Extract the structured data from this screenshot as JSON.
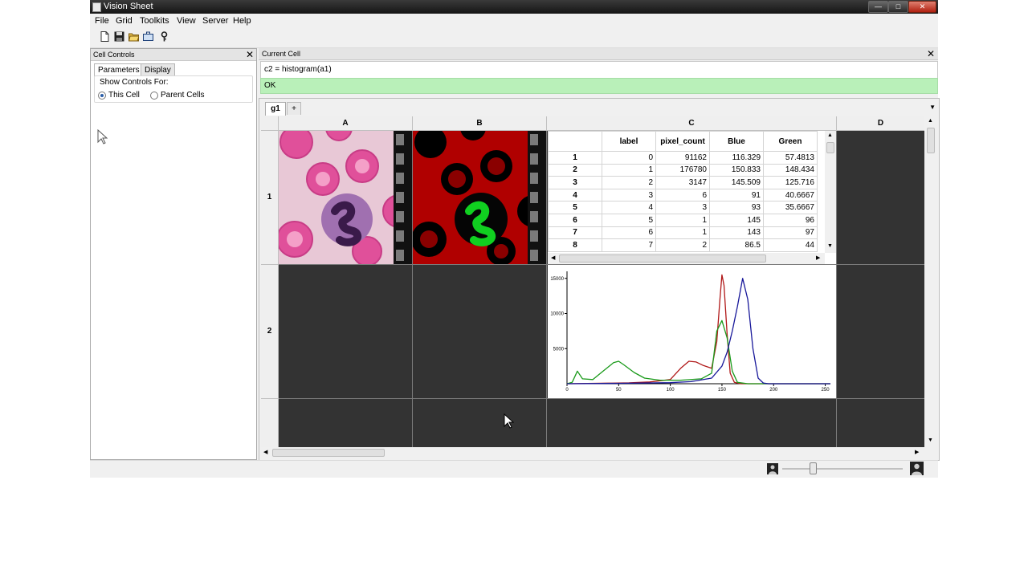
{
  "window": {
    "title": "Vision Sheet",
    "min": "—",
    "max": "□",
    "close": "✕"
  },
  "menu": [
    "File",
    "Grid",
    "Toolkits",
    "View",
    "Server",
    "Help"
  ],
  "toolbar": {
    "icons": [
      "new-file-icon",
      "save-icon",
      "open-folder-icon",
      "briefcase-icon",
      "key-icon"
    ]
  },
  "left_dock": {
    "title": "Cell Controls",
    "close": "✕",
    "tabs": [
      "Parameters",
      "Display"
    ],
    "show_controls_label": "Show Controls For:",
    "options": [
      {
        "label": "This Cell",
        "selected": true
      },
      {
        "label": "Parent Cells",
        "selected": false
      }
    ]
  },
  "current_cell": {
    "title": "Current Cell",
    "close": "✕",
    "expression": "c2 = histogram(a1)",
    "status": "OK"
  },
  "sheet": {
    "tabs": [
      "g1"
    ],
    "add_tab": "+",
    "tab_menu": "▼",
    "columns": [
      "A",
      "B",
      "C",
      "D"
    ],
    "rows": [
      "1",
      "2",
      ""
    ]
  },
  "table": {
    "headers": [
      "",
      "label",
      "pixel_count",
      "Blue",
      "Green"
    ],
    "rows": [
      [
        "1",
        "0",
        "91162",
        "116.329",
        "57.4813"
      ],
      [
        "2",
        "1",
        "176780",
        "150.833",
        "148.434"
      ],
      [
        "3",
        "2",
        "3147",
        "145.509",
        "125.716"
      ],
      [
        "4",
        "3",
        "6",
        "91",
        "40.6667"
      ],
      [
        "5",
        "4",
        "3",
        "93",
        "35.6667"
      ],
      [
        "6",
        "5",
        "1",
        "145",
        "96"
      ],
      [
        "7",
        "6",
        "1",
        "143",
        "97"
      ],
      [
        "8",
        "7",
        "2",
        "86.5",
        "44"
      ]
    ]
  },
  "chart_data": {
    "type": "line",
    "xlim": [
      0,
      255
    ],
    "ylim": [
      0,
      16000
    ],
    "xticks": [
      "0",
      "50",
      "100",
      "150",
      "200",
      "250"
    ],
    "yticks": [
      "5000",
      "10000",
      "15000"
    ],
    "grid": false,
    "series": [
      {
        "color": "#b01818",
        "x": [
          0,
          20,
          40,
          60,
          80,
          100,
          110,
          118,
          125,
          132,
          140,
          145,
          148,
          150,
          152,
          155,
          158,
          162,
          168,
          180,
          200,
          255
        ],
        "y": [
          0,
          40,
          80,
          120,
          250,
          600,
          2200,
          3200,
          3100,
          2600,
          2200,
          6000,
          12000,
          15500,
          14000,
          7000,
          1500,
          200,
          0,
          0,
          0,
          0
        ]
      },
      {
        "color": "#1a9a1a",
        "x": [
          0,
          5,
          10,
          15,
          25,
          35,
          45,
          50,
          55,
          65,
          75,
          90,
          110,
          130,
          140,
          145,
          150,
          155,
          160,
          165,
          175,
          200,
          255
        ],
        "y": [
          0,
          200,
          1800,
          700,
          600,
          1800,
          3000,
          3200,
          2700,
          1600,
          800,
          500,
          500,
          700,
          1500,
          7500,
          9000,
          6500,
          1800,
          200,
          0,
          0,
          0
        ]
      },
      {
        "color": "#18189a",
        "x": [
          0,
          20,
          50,
          100,
          120,
          140,
          150,
          155,
          160,
          165,
          170,
          175,
          180,
          185,
          190,
          195,
          200,
          255
        ],
        "y": [
          0,
          20,
          60,
          150,
          300,
          800,
          2500,
          4500,
          7500,
          11000,
          15000,
          12000,
          5000,
          800,
          100,
          0,
          0,
          0
        ]
      }
    ]
  },
  "status_bar": {}
}
